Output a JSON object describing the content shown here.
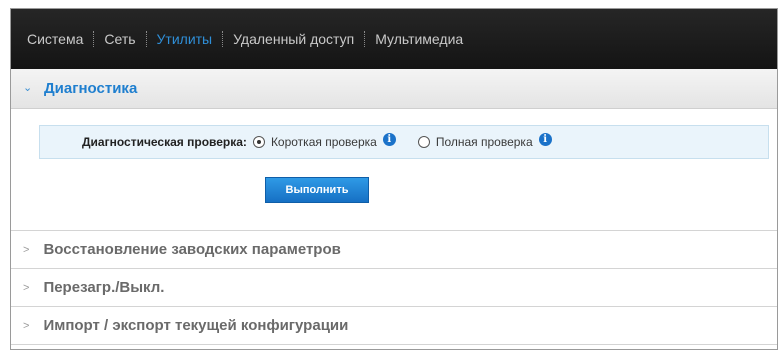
{
  "nav": {
    "items": [
      {
        "label": "Система"
      },
      {
        "label": "Сеть"
      },
      {
        "label": "Утилиты"
      },
      {
        "label": "Удаленный доступ"
      },
      {
        "label": "Мультимедиа"
      }
    ],
    "active_label": "Утилиты"
  },
  "diagnostics": {
    "title": "Диагностика",
    "check_label": "Диагностическая проверка:",
    "options": [
      {
        "label": "Короткая проверка",
        "selected": true
      },
      {
        "label": "Полная проверка",
        "selected": false
      }
    ],
    "run_button": "Выполнить"
  },
  "sections": [
    {
      "title": "Восстановление заводских параметров"
    },
    {
      "title": "Перезагр./Выкл."
    },
    {
      "title": "Импорт / экспорт текущей конфигурации"
    }
  ],
  "colors": {
    "accent": "#1f7fcf",
    "nav_bg": "#1c1c1c",
    "diag_row_bg": "#eaf4fb",
    "info_icon": "#1b72c9"
  }
}
